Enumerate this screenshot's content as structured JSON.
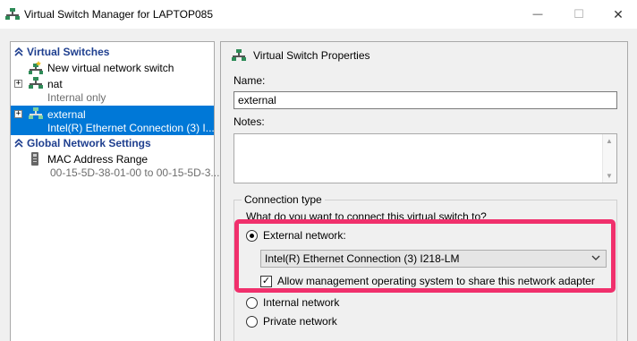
{
  "window": {
    "title": "Virtual Switch Manager for LAPTOP085",
    "minimize_glyph": "—",
    "maximize_glyph": "☐",
    "close_glyph": "✕"
  },
  "left_pane": {
    "section_virtual_switches": "Virtual Switches",
    "new_switch_label": "New virtual network switch",
    "switches": [
      {
        "name": "nat",
        "detail": "Internal only",
        "expander": "+"
      },
      {
        "name": "external",
        "detail": "Intel(R) Ethernet Connection (3) I...",
        "expander": "+"
      }
    ],
    "section_global": "Global Network Settings",
    "mac_range_label": "MAC Address Range",
    "mac_range_value": "00-15-5D-38-01-00 to 00-15-5D-3..."
  },
  "right_pane": {
    "header": "Virtual Switch Properties",
    "name_label": "Name:",
    "name_value": "external",
    "notes_label": "Notes:",
    "notes_value": "",
    "connection_type_label": "Connection type",
    "question": "What do you want to connect this virtual switch to?",
    "external_label": "External network:",
    "adapter_selected": "Intel(R) Ethernet Connection (3) I218-LM",
    "allow_mgmt_label": "Allow management operating system to share this network adapter",
    "allow_mgmt_checked": "✓",
    "internal_label": "Internal network",
    "private_label": "Private network"
  },
  "colors": {
    "selection": "#0078d7",
    "section_header": "#1f3f8f",
    "highlight": "#f0306c"
  }
}
